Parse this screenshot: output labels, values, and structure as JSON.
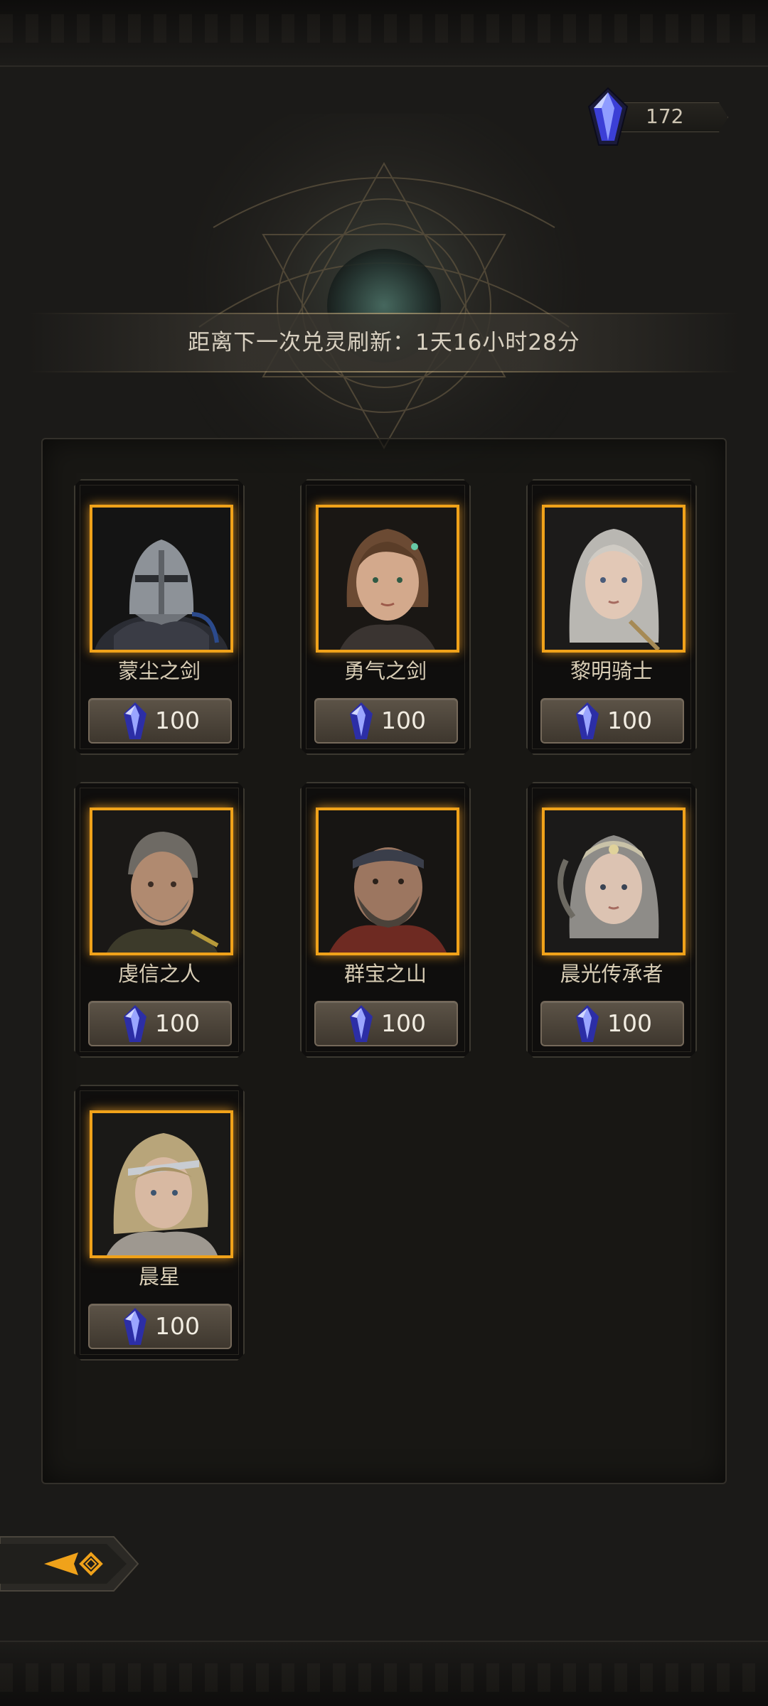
{
  "currency": {
    "icon": "crystal-icon",
    "amount": "172"
  },
  "timer": {
    "text": "距离下一次兑灵刷新：1天16小时28分"
  },
  "heroes": [
    {
      "name": "蒙尘之剑",
      "price": "100",
      "portrait": "armored-knight-helmet"
    },
    {
      "name": "勇气之剑",
      "price": "100",
      "portrait": "young-woman-brown-hair"
    },
    {
      "name": "黎明骑士",
      "price": "100",
      "portrait": "woman-silver-hair"
    },
    {
      "name": "虔信之人",
      "price": "100",
      "portrait": "bearded-man-gray-hair"
    },
    {
      "name": "群宝之山",
      "price": "100",
      "portrait": "bearded-man-headband"
    },
    {
      "name": "晨光传承者",
      "price": "100",
      "portrait": "woman-silver-headdress"
    },
    {
      "name": "晨星",
      "price": "100",
      "portrait": "blonde-woman-headband"
    }
  ],
  "colors": {
    "frame": "#f0a21a",
    "crystal": "#3b3fd6",
    "text": "#d8cdb5"
  },
  "back": {
    "icon": "back-arrow-icon"
  }
}
